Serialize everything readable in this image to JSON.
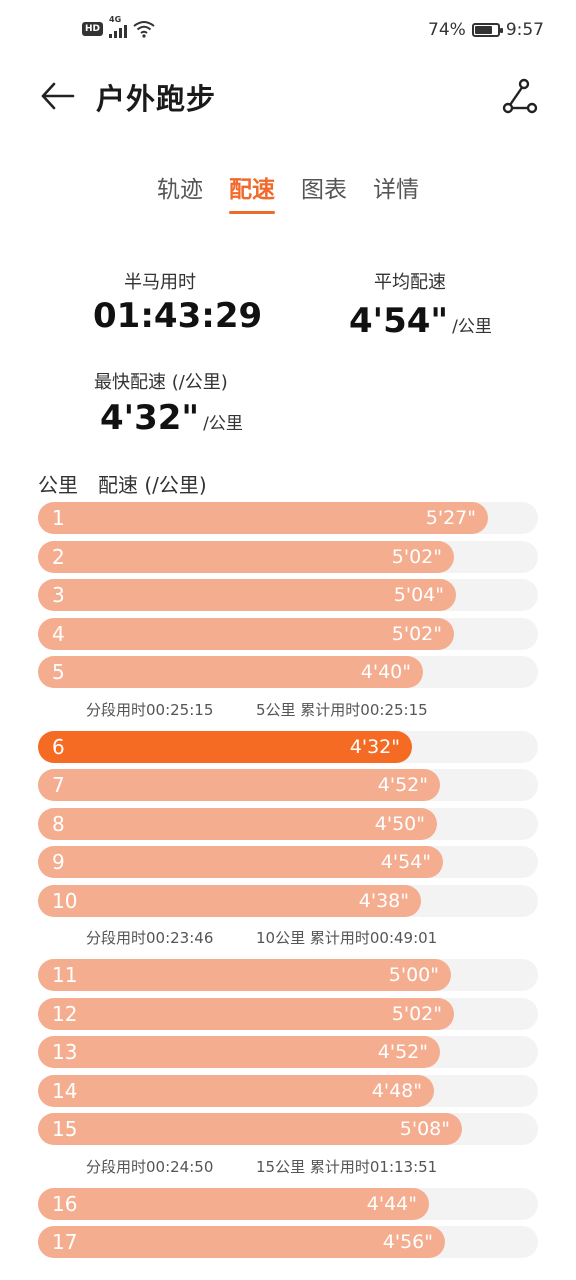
{
  "status_bar": {
    "hd": "HD",
    "network": "4G",
    "battery": "74%",
    "time": "9:57"
  },
  "header": {
    "title": "户外跑步"
  },
  "tabs": [
    {
      "label": "轨迹",
      "active": false
    },
    {
      "label": "配速",
      "active": true
    },
    {
      "label": "图表",
      "active": false
    },
    {
      "label": "详情",
      "active": false
    }
  ],
  "stats": {
    "half_marathon_label": "半马用时",
    "half_marathon_value": "01:43:29",
    "avg_pace_label": "平均配速",
    "avg_pace_value": "4'54\"",
    "avg_pace_unit": "/公里",
    "fastest_label": "最快配速 (/公里)",
    "fastest_value": "4'32\"",
    "fastest_unit": "/公里"
  },
  "list": {
    "col_km": "公里",
    "col_pace": "配速 (/公里)",
    "rows": [
      {
        "km": "1",
        "pace": "5'27\"",
        "seconds": 327
      },
      {
        "km": "2",
        "pace": "5'02\"",
        "seconds": 302
      },
      {
        "km": "3",
        "pace": "5'04\"",
        "seconds": 304
      },
      {
        "km": "4",
        "pace": "5'02\"",
        "seconds": 302
      },
      {
        "km": "5",
        "pace": "4'40\"",
        "seconds": 280
      },
      {
        "split": true,
        "segment": "分段用时00:25:15",
        "total": "5公里 累计用时00:25:15"
      },
      {
        "km": "6",
        "pace": "4'32\"",
        "seconds": 272,
        "fastest": true
      },
      {
        "km": "7",
        "pace": "4'52\"",
        "seconds": 292
      },
      {
        "km": "8",
        "pace": "4'50\"",
        "seconds": 290
      },
      {
        "km": "9",
        "pace": "4'54\"",
        "seconds": 294
      },
      {
        "km": "10",
        "pace": "4'38\"",
        "seconds": 278
      },
      {
        "split": true,
        "segment": "分段用时00:23:46",
        "total": "10公里 累计用时00:49:01"
      },
      {
        "km": "11",
        "pace": "5'00\"",
        "seconds": 300
      },
      {
        "km": "12",
        "pace": "5'02\"",
        "seconds": 302
      },
      {
        "km": "13",
        "pace": "4'52\"",
        "seconds": 292
      },
      {
        "km": "14",
        "pace": "4'48\"",
        "seconds": 288
      },
      {
        "km": "15",
        "pace": "5'08\"",
        "seconds": 308
      },
      {
        "split": true,
        "segment": "分段用时00:24:50",
        "total": "15公里 累计用时01:13:51"
      },
      {
        "km": "16",
        "pace": "4'44\"",
        "seconds": 284
      },
      {
        "km": "17",
        "pace": "4'56\"",
        "seconds": 296
      }
    ]
  },
  "colors": {
    "accent": "#f06a2b",
    "bar": "#f5ad8f",
    "fastest_bar": "#f56b23",
    "track": "#f3f3f3"
  }
}
